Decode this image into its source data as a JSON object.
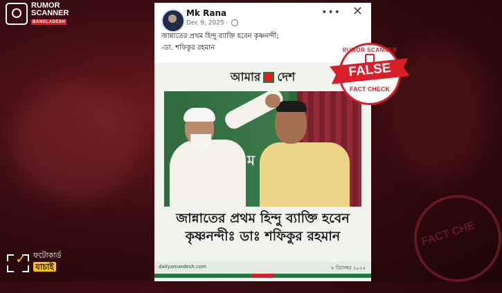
{
  "brand": {
    "top_name_1": "RUMOR",
    "top_name_2": "SCANNER",
    "top_tag": "BANGLADESH",
    "bottom_line1": "ফটোকার্ড",
    "bottom_line2": "যাচাই"
  },
  "post": {
    "author": "Mk Rana",
    "date": "Dec 9, 2025 ·",
    "more_label": "•••",
    "close_label": "✕",
    "caption_line1": "জান্নাতের প্রথম হিন্দু ব্যাক্তি হবেন কৃষ্ণনন্দী;",
    "caption_line2": "-ডা. শফিকুর রহমান"
  },
  "photocard": {
    "masthead_left": "আমার",
    "masthead_right": "দেশ",
    "photo_text": "ম",
    "headline_line1": "জান্নাতের প্রথম হিন্দু ব্যাক্তি হবেন",
    "headline_line2": "কৃষ্ণনন্দীঃ ডাঃ শফিকুর রহমান",
    "site": "dailyamardesh.com",
    "date": "৮ ডিসেম্বর ২০২৫"
  },
  "verdict": {
    "org": "RUMOR SCANNER",
    "label": "FALSE",
    "sub": "FACT CHECK"
  },
  "background_stamp": "FACT CHE",
  "colors": {
    "accent_red": "#d9202a",
    "brand_green": "#1b7a3c",
    "badge_yellow": "#f6c21b"
  }
}
